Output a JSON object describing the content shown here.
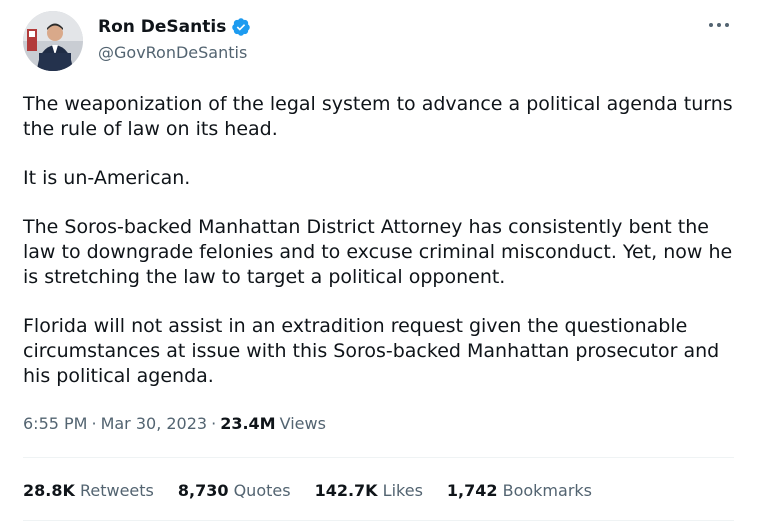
{
  "author": {
    "name": "Ron DeSantis",
    "handle": "@GovRonDeSantis",
    "verified": true
  },
  "tweet": {
    "paragraphs": [
      "The weaponization of the legal system to advance a political agenda turns the rule of law on its head.",
      "It is un-American.",
      "The Soros-backed Manhattan District Attorney has consistently bent the law to downgrade felonies and to excuse criminal misconduct. Yet, now he is stretching the law to target a political opponent.",
      "Florida will not assist in an extradition request given the questionable circumstances at issue with this Soros-backed Manhattan prosecutor and his political agenda."
    ],
    "time": "6:55 PM",
    "separator": "·",
    "date": "Mar 30, 2023",
    "views_count": "23.4M",
    "views_label": "Views"
  },
  "stats": {
    "retweets": {
      "count": "28.8K",
      "label": "Retweets"
    },
    "quotes": {
      "count": "8,730",
      "label": "Quotes"
    },
    "likes": {
      "count": "142.7K",
      "label": "Likes"
    },
    "bookmarks": {
      "count": "1,742",
      "label": "Bookmarks"
    }
  },
  "icons": {
    "verified": "verified-badge-icon",
    "more": "more-options-icon"
  },
  "colors": {
    "primary_text": "#0f1419",
    "secondary_text": "#536471",
    "verified_blue": "#1d9bf0",
    "divider": "#eff3f4"
  }
}
